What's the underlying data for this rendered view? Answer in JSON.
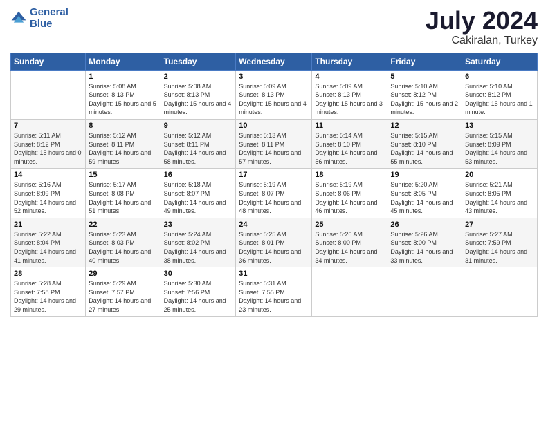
{
  "logo": {
    "line1": "General",
    "line2": "Blue"
  },
  "title": "July 2024",
  "subtitle": "Cakiralan, Turkey",
  "header_days": [
    "Sunday",
    "Monday",
    "Tuesday",
    "Wednesday",
    "Thursday",
    "Friday",
    "Saturday"
  ],
  "weeks": [
    [
      {
        "day": "",
        "sunrise": "",
        "sunset": "",
        "daylight": ""
      },
      {
        "day": "1",
        "sunrise": "Sunrise: 5:08 AM",
        "sunset": "Sunset: 8:13 PM",
        "daylight": "Daylight: 15 hours and 5 minutes."
      },
      {
        "day": "2",
        "sunrise": "Sunrise: 5:08 AM",
        "sunset": "Sunset: 8:13 PM",
        "daylight": "Daylight: 15 hours and 4 minutes."
      },
      {
        "day": "3",
        "sunrise": "Sunrise: 5:09 AM",
        "sunset": "Sunset: 8:13 PM",
        "daylight": "Daylight: 15 hours and 4 minutes."
      },
      {
        "day": "4",
        "sunrise": "Sunrise: 5:09 AM",
        "sunset": "Sunset: 8:13 PM",
        "daylight": "Daylight: 15 hours and 3 minutes."
      },
      {
        "day": "5",
        "sunrise": "Sunrise: 5:10 AM",
        "sunset": "Sunset: 8:12 PM",
        "daylight": "Daylight: 15 hours and 2 minutes."
      },
      {
        "day": "6",
        "sunrise": "Sunrise: 5:10 AM",
        "sunset": "Sunset: 8:12 PM",
        "daylight": "Daylight: 15 hours and 1 minute."
      }
    ],
    [
      {
        "day": "7",
        "sunrise": "Sunrise: 5:11 AM",
        "sunset": "Sunset: 8:12 PM",
        "daylight": "Daylight: 15 hours and 0 minutes."
      },
      {
        "day": "8",
        "sunrise": "Sunrise: 5:12 AM",
        "sunset": "Sunset: 8:11 PM",
        "daylight": "Daylight: 14 hours and 59 minutes."
      },
      {
        "day": "9",
        "sunrise": "Sunrise: 5:12 AM",
        "sunset": "Sunset: 8:11 PM",
        "daylight": "Daylight: 14 hours and 58 minutes."
      },
      {
        "day": "10",
        "sunrise": "Sunrise: 5:13 AM",
        "sunset": "Sunset: 8:11 PM",
        "daylight": "Daylight: 14 hours and 57 minutes."
      },
      {
        "day": "11",
        "sunrise": "Sunrise: 5:14 AM",
        "sunset": "Sunset: 8:10 PM",
        "daylight": "Daylight: 14 hours and 56 minutes."
      },
      {
        "day": "12",
        "sunrise": "Sunrise: 5:15 AM",
        "sunset": "Sunset: 8:10 PM",
        "daylight": "Daylight: 14 hours and 55 minutes."
      },
      {
        "day": "13",
        "sunrise": "Sunrise: 5:15 AM",
        "sunset": "Sunset: 8:09 PM",
        "daylight": "Daylight: 14 hours and 53 minutes."
      }
    ],
    [
      {
        "day": "14",
        "sunrise": "Sunrise: 5:16 AM",
        "sunset": "Sunset: 8:09 PM",
        "daylight": "Daylight: 14 hours and 52 minutes."
      },
      {
        "day": "15",
        "sunrise": "Sunrise: 5:17 AM",
        "sunset": "Sunset: 8:08 PM",
        "daylight": "Daylight: 14 hours and 51 minutes."
      },
      {
        "day": "16",
        "sunrise": "Sunrise: 5:18 AM",
        "sunset": "Sunset: 8:07 PM",
        "daylight": "Daylight: 14 hours and 49 minutes."
      },
      {
        "day": "17",
        "sunrise": "Sunrise: 5:19 AM",
        "sunset": "Sunset: 8:07 PM",
        "daylight": "Daylight: 14 hours and 48 minutes."
      },
      {
        "day": "18",
        "sunrise": "Sunrise: 5:19 AM",
        "sunset": "Sunset: 8:06 PM",
        "daylight": "Daylight: 14 hours and 46 minutes."
      },
      {
        "day": "19",
        "sunrise": "Sunrise: 5:20 AM",
        "sunset": "Sunset: 8:05 PM",
        "daylight": "Daylight: 14 hours and 45 minutes."
      },
      {
        "day": "20",
        "sunrise": "Sunrise: 5:21 AM",
        "sunset": "Sunset: 8:05 PM",
        "daylight": "Daylight: 14 hours and 43 minutes."
      }
    ],
    [
      {
        "day": "21",
        "sunrise": "Sunrise: 5:22 AM",
        "sunset": "Sunset: 8:04 PM",
        "daylight": "Daylight: 14 hours and 41 minutes."
      },
      {
        "day": "22",
        "sunrise": "Sunrise: 5:23 AM",
        "sunset": "Sunset: 8:03 PM",
        "daylight": "Daylight: 14 hours and 40 minutes."
      },
      {
        "day": "23",
        "sunrise": "Sunrise: 5:24 AM",
        "sunset": "Sunset: 8:02 PM",
        "daylight": "Daylight: 14 hours and 38 minutes."
      },
      {
        "day": "24",
        "sunrise": "Sunrise: 5:25 AM",
        "sunset": "Sunset: 8:01 PM",
        "daylight": "Daylight: 14 hours and 36 minutes."
      },
      {
        "day": "25",
        "sunrise": "Sunrise: 5:26 AM",
        "sunset": "Sunset: 8:00 PM",
        "daylight": "Daylight: 14 hours and 34 minutes."
      },
      {
        "day": "26",
        "sunrise": "Sunrise: 5:26 AM",
        "sunset": "Sunset: 8:00 PM",
        "daylight": "Daylight: 14 hours and 33 minutes."
      },
      {
        "day": "27",
        "sunrise": "Sunrise: 5:27 AM",
        "sunset": "Sunset: 7:59 PM",
        "daylight": "Daylight: 14 hours and 31 minutes."
      }
    ],
    [
      {
        "day": "28",
        "sunrise": "Sunrise: 5:28 AM",
        "sunset": "Sunset: 7:58 PM",
        "daylight": "Daylight: 14 hours and 29 minutes."
      },
      {
        "day": "29",
        "sunrise": "Sunrise: 5:29 AM",
        "sunset": "Sunset: 7:57 PM",
        "daylight": "Daylight: 14 hours and 27 minutes."
      },
      {
        "day": "30",
        "sunrise": "Sunrise: 5:30 AM",
        "sunset": "Sunset: 7:56 PM",
        "daylight": "Daylight: 14 hours and 25 minutes."
      },
      {
        "day": "31",
        "sunrise": "Sunrise: 5:31 AM",
        "sunset": "Sunset: 7:55 PM",
        "daylight": "Daylight: 14 hours and 23 minutes."
      },
      {
        "day": "",
        "sunrise": "",
        "sunset": "",
        "daylight": ""
      },
      {
        "day": "",
        "sunrise": "",
        "sunset": "",
        "daylight": ""
      },
      {
        "day": "",
        "sunrise": "",
        "sunset": "",
        "daylight": ""
      }
    ]
  ]
}
